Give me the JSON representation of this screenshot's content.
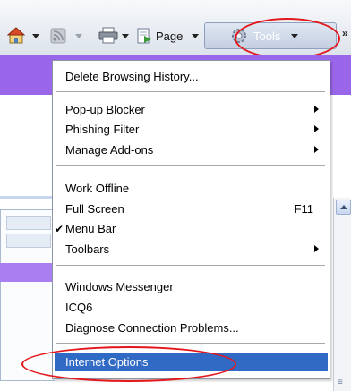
{
  "toolbar": {
    "page_label": "Page",
    "tools_label": "Tools",
    "overflow_glyph": "»"
  },
  "menu": {
    "items": [
      {
        "label": "Delete Browsing History..."
      },
      {
        "label": "Pop-up Blocker",
        "submenu": true
      },
      {
        "label": "Phishing Filter",
        "submenu": true
      },
      {
        "label": "Manage Add-ons",
        "submenu": true
      },
      {
        "label": "Work Offline"
      },
      {
        "label": "Full Screen",
        "shortcut": "F11"
      },
      {
        "label": "Menu Bar",
        "checked": true,
        "check_glyph": "✔"
      },
      {
        "label": "Toolbars",
        "submenu": true
      },
      {
        "label": "Windows Messenger"
      },
      {
        "label": "ICQ6"
      },
      {
        "label": "Diagnose Connection Problems..."
      },
      {
        "label": "Internet Options",
        "selected": true
      }
    ]
  },
  "colors": {
    "highlight_circle": "#e3161b",
    "menu_selection": "#316ac5",
    "page_purple": "#9a66e9"
  }
}
